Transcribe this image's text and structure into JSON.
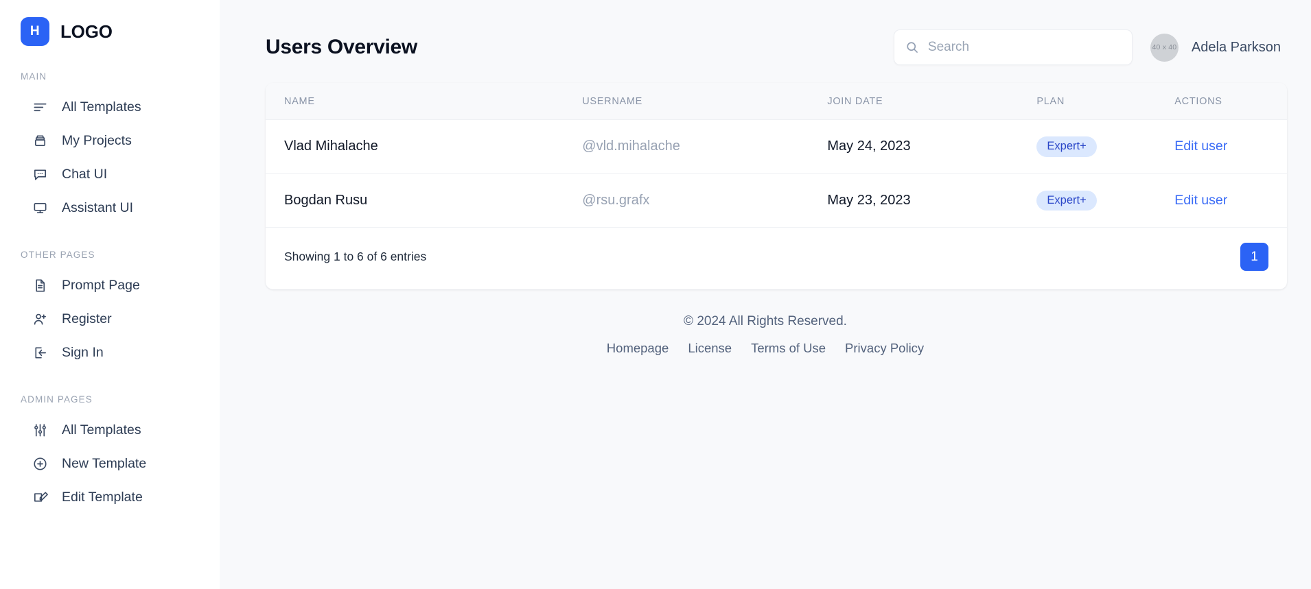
{
  "brand": {
    "mark_letter": "H",
    "name": "LOGO"
  },
  "sidebar": {
    "sections": [
      {
        "title": "MAIN",
        "items": [
          {
            "label": "All Templates",
            "icon": "list-icon"
          },
          {
            "label": "My Projects",
            "icon": "archive-box-icon"
          },
          {
            "label": "Chat UI",
            "icon": "chat-bubble-icon"
          },
          {
            "label": "Assistant UI",
            "icon": "monitor-icon"
          }
        ]
      },
      {
        "title": "OTHER PAGES",
        "items": [
          {
            "label": "Prompt Page",
            "icon": "document-icon"
          },
          {
            "label": "Register",
            "icon": "user-plus-icon"
          },
          {
            "label": "Sign In",
            "icon": "sign-in-icon"
          }
        ]
      },
      {
        "title": "ADMIN PAGES",
        "items": [
          {
            "label": "All Templates",
            "icon": "sliders-icon"
          },
          {
            "label": "New Template",
            "icon": "plus-circle-icon"
          },
          {
            "label": "Edit Template",
            "icon": "edit-template-icon"
          }
        ]
      }
    ]
  },
  "header": {
    "title": "Users Overview",
    "search": {
      "placeholder": "Search",
      "value": "",
      "icon": "search-icon"
    },
    "profile": {
      "avatar_label": "40 x 40",
      "name": "Adela Parkson"
    }
  },
  "table": {
    "columns": [
      "NAME",
      "USERNAME",
      "JOIN DATE",
      "PLAN",
      "ACTIONS"
    ],
    "rows": [
      {
        "name": "Vlad Mihalache",
        "username": "@vld.mihalache",
        "join_date": "May 24, 2023",
        "plan": "Expert+",
        "action": "Edit user"
      },
      {
        "name": "Bogdan Rusu",
        "username": "@rsu.grafx",
        "join_date": "May 23, 2023",
        "plan": "Expert+",
        "action": "Edit user"
      }
    ],
    "footer": {
      "entries_text": "Showing 1 to 6 of 6 entries",
      "pages": [
        "1"
      ]
    }
  },
  "footer": {
    "copyright": "© 2024 All Rights Reserved.",
    "links": [
      "Homepage",
      "License",
      "Terms of Use",
      "Privacy Policy"
    ]
  },
  "colors": {
    "brand_blue": "#2b63f5",
    "link_blue": "#3b6cf6",
    "badge_bg": "#dbe8fe",
    "badge_text": "#2a46c8",
    "page_bg": "#f8f9fb"
  }
}
